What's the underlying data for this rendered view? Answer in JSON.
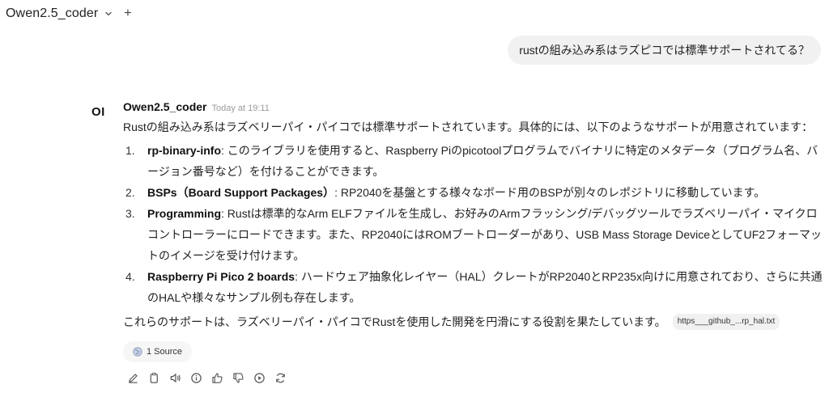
{
  "header": {
    "model_name": "Owen2.5_coder",
    "chevron_icon": "chevron-down-icon",
    "new_icon": "plus-icon"
  },
  "user_message": {
    "text": "rustの組み込み系はラズピコでは標準サポートされてる？"
  },
  "assistant": {
    "avatar": "OI",
    "sender": "Owen2.5_coder",
    "time": "Today at 19:11",
    "intro": "Rustの組み込み系はラズベリーパイ・パイコでは標準サポートされています。具体的には、以下のようなサポートが用意されています：",
    "points": [
      {
        "num": "1.",
        "title": "rp-binary-info",
        "text": ": このライブラリを使用すると、Raspberry Piのpicotoolプログラムでバイナリに特定のメタデータ（プログラム名、バージョン番号など）を付けることができます。"
      },
      {
        "num": "2.",
        "title": "BSPs（Board Support Packages）",
        "text": ": RP2040を基盤とする様々なボード用のBSPが別々のレポジトリに移動しています。"
      },
      {
        "num": "3.",
        "title": "Programming",
        "text": ": Rustは標準的なArm ELFファイルを生成し、お好みのArmフラッシング/デバッグツールでラズベリーパイ・マイクロコントローラーにロードできます。また、RP2040にはROMブートローダーがあり、USB Mass Storage DeviceとしてUF2フォーマットのイメージを受け付けます。"
      },
      {
        "num": "4.",
        "title": "Raspberry Pi Pico 2 boards",
        "text": ": ハードウェア抽象化レイヤー（HAL）クレートがRP2040とRP235x向けに用意されており、さらに共通のHALや様々なサンプル例も存在します。"
      }
    ],
    "closing": "これらのサポートは、ラズベリーパイ・パイコでRustを使用した開発を円滑にする役割を果たしています。",
    "citation": "https___github_...rp_hal.txt",
    "sources_label": "1 Source"
  },
  "actions": [
    "edit-icon",
    "copy-icon",
    "read-aloud-icon",
    "info-icon",
    "thumbs-up-icon",
    "thumbs-down-icon",
    "continue-icon",
    "regenerate-icon"
  ],
  "colors": {
    "user_bubble": "#f1f1f1",
    "timestamp": "#9a9a9a",
    "source_pill": "#f6f6f6"
  }
}
